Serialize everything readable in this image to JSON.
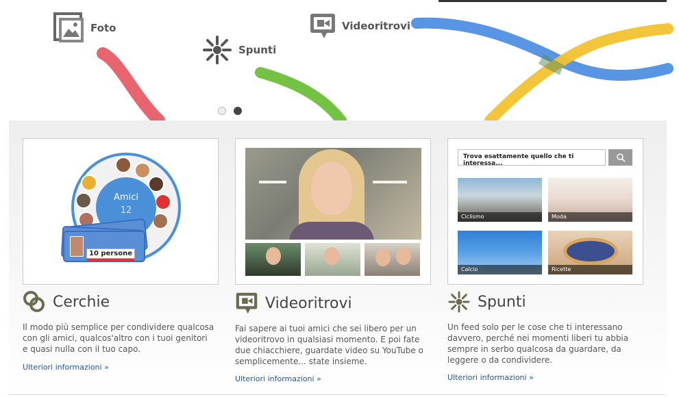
{
  "hero": {
    "items": [
      {
        "label": "Foto",
        "icon": "photo-icon"
      },
      {
        "label": "Spunti",
        "icon": "spark-icon"
      },
      {
        "label": "Videoritrovi",
        "icon": "video-chat-icon"
      }
    ],
    "slides": 2,
    "active_slide": 2
  },
  "colors": {
    "accent_blue": "#4a90d9",
    "link": "#2255aa",
    "swirl_red": "#e5545f",
    "swirl_green": "#6cbf3a",
    "swirl_blue": "#4f8fe0",
    "swirl_yellow": "#f2c230"
  },
  "columns": [
    {
      "title": "Cerchie",
      "icon": "circles-icon",
      "description": "Il modo più semplice per condividere qualcosa con gli amici, qualcos'altro con i tuoi genitori e quasi nulla con il tuo capo.",
      "link": "Ulteriori informazioni »",
      "illustration": {
        "circle_name": "Amici",
        "circle_count": "12",
        "people_tag": "10 persone"
      }
    },
    {
      "title": "Videoritrovi",
      "icon": "video-chat-icon",
      "description": "Fai sapere ai tuoi amici che sei libero per un videoritrovo in qualsiasi momento. E poi fate due chiacchiere, guardate video su YouTube o semplicemente... state insieme.",
      "link": "Ulteriori informazioni »"
    },
    {
      "title": "Spunti",
      "icon": "spark-icon",
      "description": "Un feed solo per le cose che ti interessano davvero, perché nei momenti liberi tu abbia sempre in serbo qualcosa da guardare, da leggere o da condividere.",
      "link": "Ulteriori informazioni »",
      "illustration": {
        "search_value": "Trova esattamente quello che ti interessa...",
        "tiles": [
          "Ciclismo",
          "Moda",
          "Calcio",
          "Ricette"
        ]
      }
    }
  ]
}
